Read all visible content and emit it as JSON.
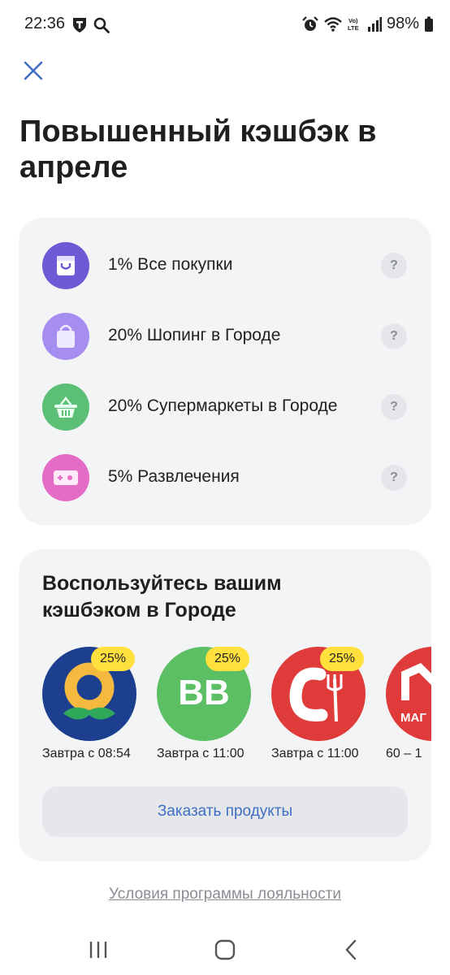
{
  "status_bar": {
    "time": "22:36",
    "battery": "98%",
    "icons": [
      "shield-icon",
      "search-icon",
      "alarm-icon",
      "wifi-icon",
      "volte-icon",
      "signal-icon",
      "battery-icon"
    ]
  },
  "header": {
    "close_icon": "close-icon",
    "title": "Повышенный кэшбэк в апреле"
  },
  "cashback": {
    "items": [
      {
        "label": "1% Все покупки",
        "help": "?",
        "icon": "shopping-bag-icon",
        "color": "#6c5bd4"
      },
      {
        "label": "20% Шопинг в Городе",
        "help": "?",
        "icon": "bag-icon",
        "color": "#a68ef0"
      },
      {
        "label": "20% Супермаркеты в Городе",
        "help": "?",
        "icon": "basket-icon",
        "color": "#5cbf76"
      },
      {
        "label": "5% Развлечения",
        "help": "?",
        "icon": "ticket-icon",
        "color": "#e56cc6"
      }
    ]
  },
  "city": {
    "title": "Воспользуйтесь вашим кэшбэком в Городе",
    "stores": [
      {
        "badge": "25%",
        "time": "Завтра с 08:54",
        "logo": "flower-logo"
      },
      {
        "badge": "25%",
        "time": "Завтра с 11:00",
        "logo": "vv-logo",
        "logo_text": "BB"
      },
      {
        "badge": "25%",
        "time": "Завтра с 11:00",
        "logo": "fork-logo"
      },
      {
        "badge": "",
        "time": "60 – 1",
        "logo": "magnit-logo",
        "logo_text": "МАГ"
      }
    ],
    "order_button": "Заказать продукты"
  },
  "footer": {
    "terms_link": "Условия программы лояльности"
  },
  "nav": {
    "buttons": [
      "recents-icon",
      "home-icon",
      "back-icon"
    ]
  },
  "colors": {
    "accent": "#3f6fc4",
    "badge": "#ffe03d",
    "card_bg": "#f3f4f6"
  }
}
